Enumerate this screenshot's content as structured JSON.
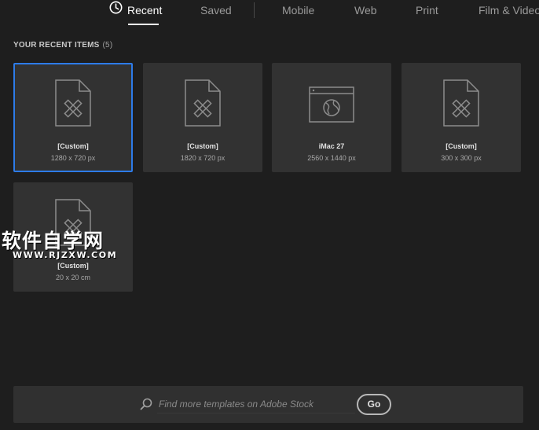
{
  "tabs": [
    {
      "label": "Recent",
      "active": true
    },
    {
      "label": "Saved",
      "active": false
    },
    {
      "label": "Mobile",
      "active": false
    },
    {
      "label": "Web",
      "active": false
    },
    {
      "label": "Print",
      "active": false
    },
    {
      "label": "Film & Video",
      "active": false
    }
  ],
  "recent": {
    "title": "YOUR RECENT ITEMS",
    "count": "(5)",
    "items": [
      {
        "name": "[Custom]",
        "size": "1280 x 720 px",
        "icon": "custom-document-icon",
        "selected": true
      },
      {
        "name": "[Custom]",
        "size": "1820 x 720 px",
        "icon": "custom-document-icon",
        "selected": false
      },
      {
        "name": "iMac 27",
        "size": "2560 x 1440 px",
        "icon": "web-browser-icon",
        "selected": false
      },
      {
        "name": "[Custom]",
        "size": "300 x 300 px",
        "icon": "custom-document-icon",
        "selected": false
      },
      {
        "name": "[Custom]",
        "size": "20 x 20 cm",
        "icon": "custom-document-icon",
        "selected": false
      }
    ]
  },
  "watermark": {
    "text": "软件自学网",
    "url": "WWW.RJZXW.COM"
  },
  "search": {
    "placeholder": "Find more templates on Adobe Stock",
    "value": "",
    "go_label": "Go"
  },
  "colors": {
    "background": "#1e1e1e",
    "card": "#323232",
    "selected_border": "#2d7be8",
    "active_tab": "#ffffff",
    "inactive_tab": "#9a9a9a"
  }
}
